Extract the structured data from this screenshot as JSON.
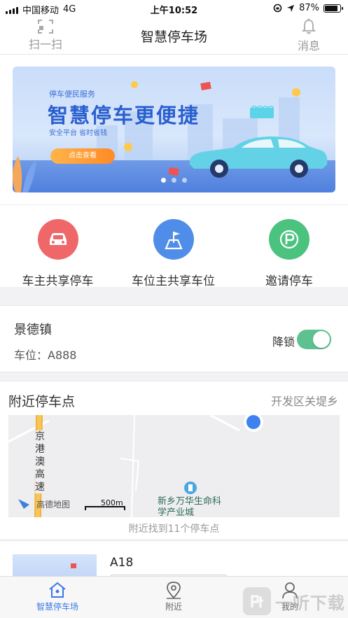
{
  "status_bar": {
    "carrier": "中国移动",
    "network": "4G",
    "time": "上午10:52",
    "battery": "87%",
    "battery_level": 0.87
  },
  "header": {
    "title": "智慧停车场",
    "scan_label": "扫一扫",
    "message_label": "消息"
  },
  "banner": {
    "kicker": "停车便民服务",
    "headline": "智慧停车更便捷",
    "subtitle": "安全平台 省时省钱",
    "cta": "点击查看",
    "slides": 3,
    "active_slide": 1
  },
  "services": [
    {
      "label": "车主共享停车",
      "icon": "car-icon",
      "color": "#f0676a"
    },
    {
      "label": "车位主共享车位",
      "icon": "parking-flag-icon",
      "color": "#4f8de8"
    },
    {
      "label": "邀请停车",
      "icon": "parking-p-icon",
      "color": "#4cc27f"
    }
  ],
  "spot_card": {
    "location": "景德镇",
    "space_code": "车位：A888",
    "lock_label": "降锁",
    "lock_on": true
  },
  "nearby": {
    "title": "附近停车点",
    "area": "开发区关堤乡",
    "map": {
      "road_label": "京港澳高速",
      "poi_label": "新乡万华生命科学产业城",
      "provider": "高德地图",
      "scale": "500m"
    },
    "found_text": "附近找到11个停车点"
  },
  "list_item": {
    "name": "A18"
  },
  "tabs": [
    {
      "label": "智慧停车场",
      "icon": "home-icon",
      "active": true
    },
    {
      "label": "附近",
      "icon": "location-pin-icon",
      "active": false
    },
    {
      "label": "我的",
      "icon": "user-icon",
      "active": false
    }
  ],
  "watermark": {
    "text": "一听下载"
  },
  "colors": {
    "accent": "#3b78e7",
    "toggle_on": "#5fc18f"
  }
}
